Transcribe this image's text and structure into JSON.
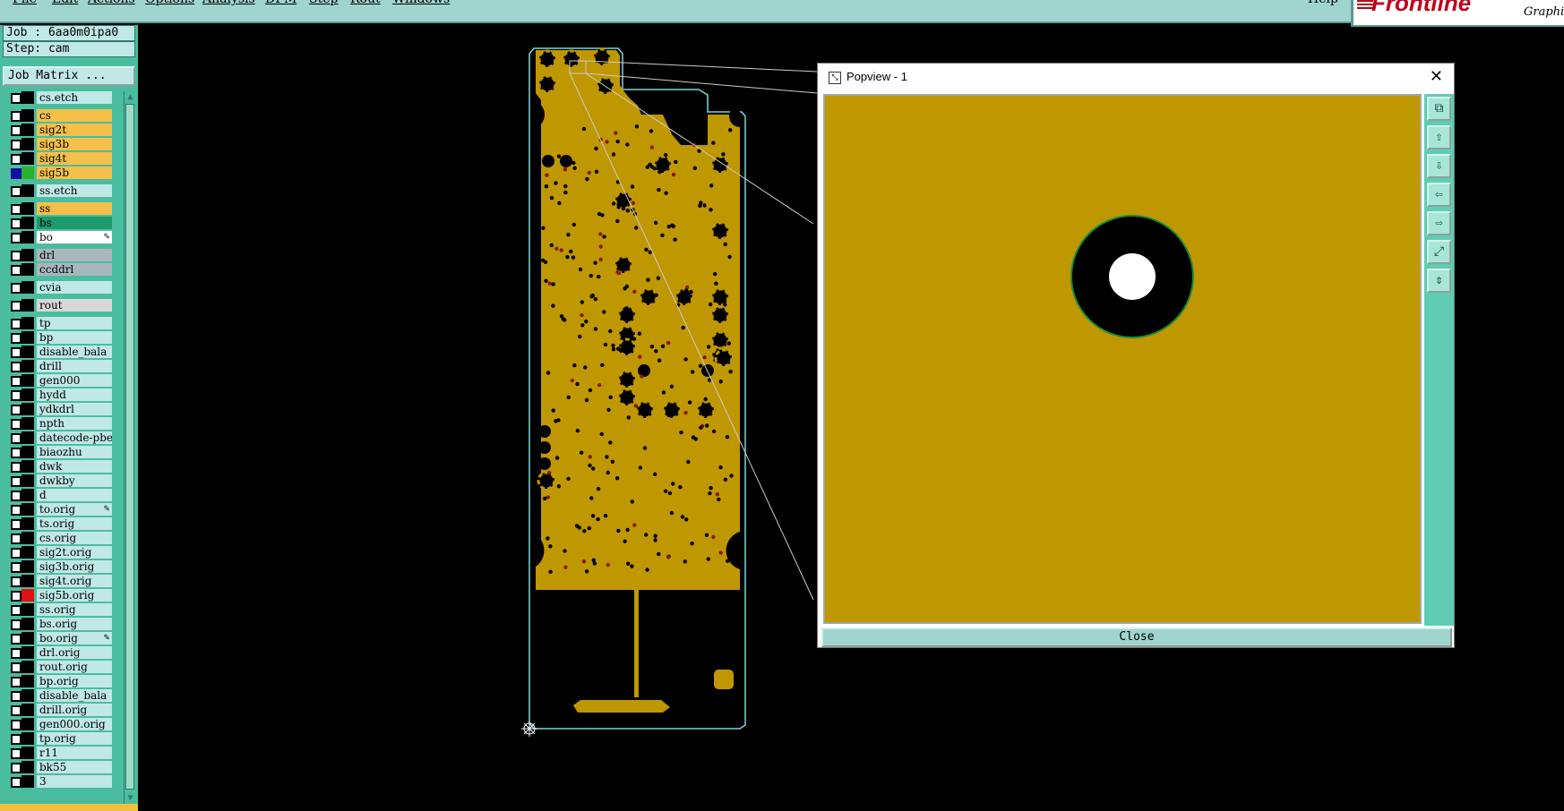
{
  "menubar": {
    "items": [
      "File",
      "Edit",
      "Actions",
      "Options",
      "Analysis",
      "DFM",
      "Step",
      "Rout",
      "Windows"
    ],
    "help": "Help"
  },
  "brand": {
    "logo": "Frontline",
    "graphic": "Graphic"
  },
  "left_panel": {
    "job": "Job : 6aa0m0ipa0",
    "step": "Step: cam",
    "job_matrix": "Job Matrix ...",
    "layers": [
      {
        "name": "cs.etch",
        "bg": "#bfe8e6",
        "color": "#000000",
        "checked": false
      },
      {
        "name": "cs",
        "bg": "#f5c04a",
        "color": "#000000",
        "checked": false
      },
      {
        "name": "sig2t",
        "bg": "#f5c04a",
        "color": "#000000",
        "checked": false
      },
      {
        "name": "sig3b",
        "bg": "#f5c04a",
        "color": "#000000",
        "checked": false
      },
      {
        "name": "sig4t",
        "bg": "#f5c04a",
        "color": "#000000",
        "checked": false
      },
      {
        "name": "sig5b",
        "bg": "#f5c04a",
        "color": "#2bb22b",
        "checked": true
      },
      {
        "name": "ss.etch",
        "bg": "#bfe8e6",
        "color": "#000000",
        "checked": false
      },
      {
        "name": "ss",
        "bg": "#f5c04a",
        "color": "#000000",
        "checked": false
      },
      {
        "name": "bs",
        "bg": "#1d9a6c",
        "color": "#000000",
        "checked": false
      },
      {
        "name": "bo",
        "bg": "#ffffff",
        "color": "#000000",
        "checked": false,
        "mark": "✎"
      },
      {
        "name": "drl",
        "bg": "#a9b6bb",
        "color": "#000000",
        "checked": false
      },
      {
        "name": "ccddrl",
        "bg": "#a9b6bb",
        "color": "#000000",
        "checked": false
      },
      {
        "name": "cvia",
        "bg": "#bfe8e6",
        "color": "#000000",
        "checked": false
      },
      {
        "name": "rout",
        "bg": "#d8d8d8",
        "color": "#000000",
        "checked": false
      },
      {
        "name": "tp",
        "bg": "#bfe8e6",
        "color": "#000000",
        "checked": false
      },
      {
        "name": "bp",
        "bg": "#bfe8e6",
        "color": "#000000",
        "checked": false
      },
      {
        "name": "disable_bala",
        "bg": "#bfe8e6",
        "color": "#000000",
        "checked": false
      },
      {
        "name": "drill",
        "bg": "#bfe8e6",
        "color": "#000000",
        "checked": false
      },
      {
        "name": "gen000",
        "bg": "#bfe8e6",
        "color": "#000000",
        "checked": false
      },
      {
        "name": "hydd",
        "bg": "#bfe8e6",
        "color": "#000000",
        "checked": false
      },
      {
        "name": "ydkdrl",
        "bg": "#bfe8e6",
        "color": "#000000",
        "checked": false
      },
      {
        "name": "npth",
        "bg": "#bfe8e6",
        "color": "#000000",
        "checked": false
      },
      {
        "name": "datecode-pbe",
        "bg": "#bfe8e6",
        "color": "#000000",
        "checked": false
      },
      {
        "name": "biaozhu",
        "bg": "#bfe8e6",
        "color": "#000000",
        "checked": false
      },
      {
        "name": "dwk",
        "bg": "#bfe8e6",
        "color": "#000000",
        "checked": false
      },
      {
        "name": "dwkby",
        "bg": "#bfe8e6",
        "color": "#000000",
        "checked": false
      },
      {
        "name": "d",
        "bg": "#bfe8e6",
        "color": "#000000",
        "checked": false
      },
      {
        "name": "to.orig",
        "bg": "#bfe8e6",
        "color": "#000000",
        "checked": false,
        "mark": "✎"
      },
      {
        "name": "ts.orig",
        "bg": "#bfe8e6",
        "color": "#000000",
        "checked": false
      },
      {
        "name": "cs.orig",
        "bg": "#bfe8e6",
        "color": "#000000",
        "checked": false
      },
      {
        "name": "sig2t.orig",
        "bg": "#bfe8e6",
        "color": "#000000",
        "checked": false
      },
      {
        "name": "sig3b.orig",
        "bg": "#bfe8e6",
        "color": "#000000",
        "checked": false
      },
      {
        "name": "sig4t.orig",
        "bg": "#bfe8e6",
        "color": "#000000",
        "checked": false
      },
      {
        "name": "sig5b.orig",
        "bg": "#bfe8e6",
        "color": "#e01010",
        "checked": false
      },
      {
        "name": "ss.orig",
        "bg": "#bfe8e6",
        "color": "#000000",
        "checked": false
      },
      {
        "name": "bs.orig",
        "bg": "#bfe8e6",
        "color": "#000000",
        "checked": false
      },
      {
        "name": "bo.orig",
        "bg": "#bfe8e6",
        "color": "#000000",
        "checked": false,
        "mark": "✎"
      },
      {
        "name": "drl.orig",
        "bg": "#bfe8e6",
        "color": "#000000",
        "checked": false
      },
      {
        "name": "rout.orig",
        "bg": "#bfe8e6",
        "color": "#000000",
        "checked": false
      },
      {
        "name": "bp.orig",
        "bg": "#bfe8e6",
        "color": "#000000",
        "checked": false
      },
      {
        "name": "disable_bala",
        "bg": "#bfe8e6",
        "color": "#000000",
        "checked": false
      },
      {
        "name": "drill.orig",
        "bg": "#bfe8e6",
        "color": "#000000",
        "checked": false
      },
      {
        "name": "gen000.orig",
        "bg": "#bfe8e6",
        "color": "#000000",
        "checked": false
      },
      {
        "name": "tp.orig",
        "bg": "#bfe8e6",
        "color": "#000000",
        "checked": false
      },
      {
        "name": "r11",
        "bg": "#bfe8e6",
        "color": "#000000",
        "checked": false
      },
      {
        "name": "bk55",
        "bg": "#bfe8e6",
        "color": "#000000",
        "checked": false
      },
      {
        "name": "3",
        "bg": "#bfe8e6",
        "color": "#000000",
        "checked": false
      }
    ]
  },
  "popview": {
    "title": "Popview - 1",
    "close_label": "Close",
    "tools": [
      "zoom-window-icon",
      "move-up-icon",
      "move-down-icon",
      "move-left-icon",
      "move-right-icon",
      "fit-all-icon",
      "fit-profile-icon"
    ]
  },
  "colors": {
    "copper": "#bf9700",
    "profile": "#7fd6d8",
    "panel": "#4bbd9f",
    "menubar": "#9fd4cf",
    "brand_red": "#c00018"
  }
}
